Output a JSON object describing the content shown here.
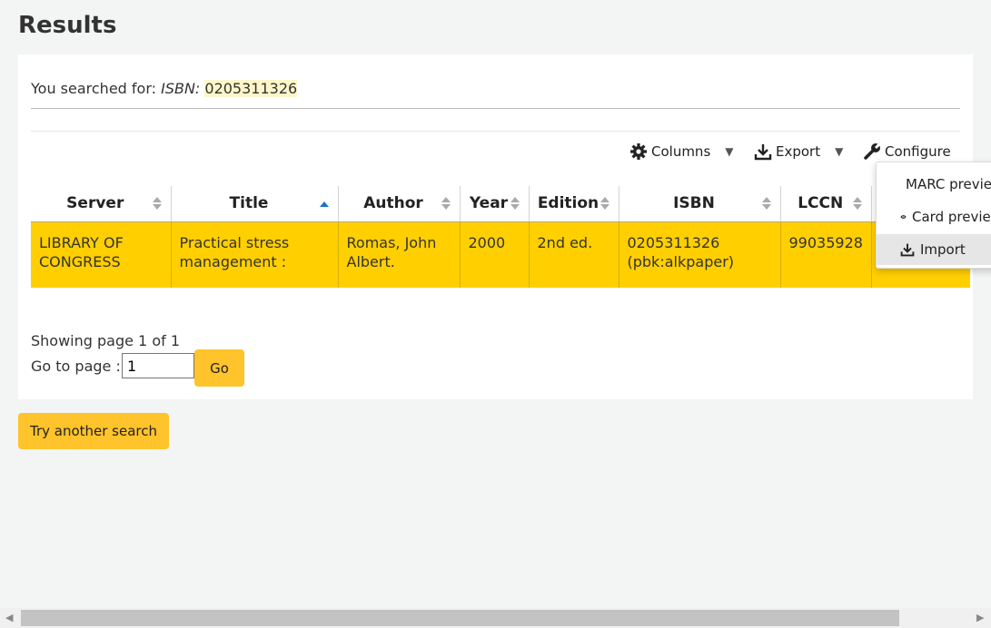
{
  "page": {
    "title": "Results"
  },
  "search": {
    "prefix": "You searched for: ",
    "term_label": "ISBN: ",
    "term_value": "0205311326"
  },
  "toolbar": {
    "columns_label": "Columns",
    "export_label": "Export",
    "configure_label": "Configure"
  },
  "table": {
    "headers": [
      "Server",
      "Title",
      "Author",
      "Year",
      "Edition",
      "ISBN",
      "LCCN"
    ],
    "rows": [
      {
        "server": "LIBRARY OF CONGRESS",
        "title": "Practical stress management :",
        "author": "Romas, John Albert.",
        "year": "2000",
        "edition": "2nd ed.",
        "isbn": "0205311326 (pbk:alkpaper)",
        "lccn": "99035928"
      }
    ]
  },
  "row_menu": {
    "items": [
      "MARC preview",
      "Card preview",
      "Import"
    ],
    "active_index": 2
  },
  "pagination": {
    "showing": "Showing page 1 of 1",
    "goto_label": "Go to page :",
    "page_value": "1",
    "go_label": "Go"
  },
  "actions": {
    "try_another_label": "Try another search"
  },
  "colors": {
    "row_highlight": "#ffcf00",
    "button": "#ffc32b",
    "sort_active": "#1a73c8"
  }
}
